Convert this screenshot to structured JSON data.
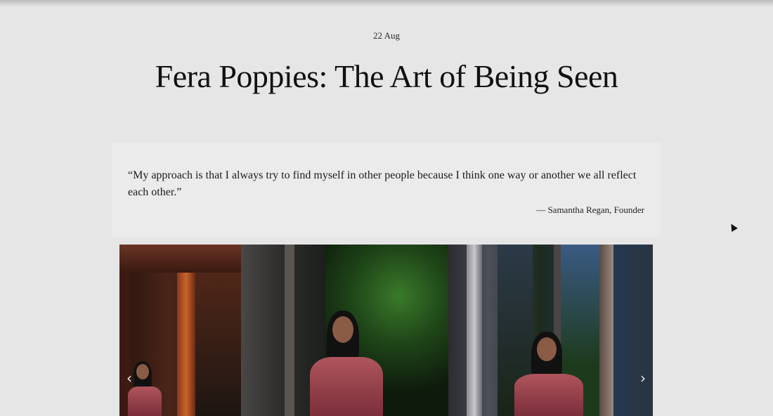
{
  "article": {
    "date": "22 Aug",
    "title": "Fera Poppies: The Art of Being Seen"
  },
  "quote": {
    "text": "“My approach is that I always try to find myself in other people because I think one way or another we all reflect each other.”",
    "author": "— Samantha Regan, Founder"
  },
  "gallery": {
    "prev_icon": "‹",
    "next_icon": "›"
  }
}
